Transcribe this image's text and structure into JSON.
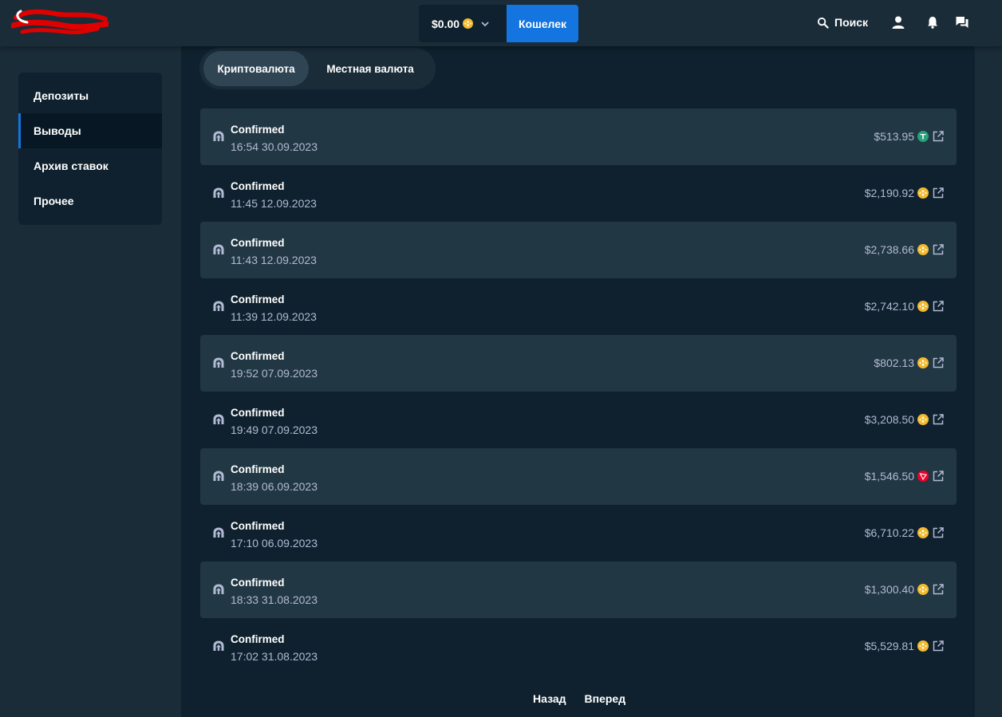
{
  "header": {
    "balance": "$0.00",
    "wallet_label": "Кошелек",
    "search_label": "Поиск"
  },
  "sidebar": {
    "items": [
      {
        "label": "Депозиты"
      },
      {
        "label": "Выводы"
      },
      {
        "label": "Архив ставок"
      },
      {
        "label": "Прочее"
      }
    ]
  },
  "tabs": {
    "crypto": "Криптовалюта",
    "local": "Местная валюта"
  },
  "transactions": [
    {
      "status": "Confirmed",
      "date": "16:54 30.09.2023",
      "amount": "$513.95",
      "currency": "usdt"
    },
    {
      "status": "Confirmed",
      "date": "11:45 12.09.2023",
      "amount": "$2,190.92",
      "currency": "bnb"
    },
    {
      "status": "Confirmed",
      "date": "11:43 12.09.2023",
      "amount": "$2,738.66",
      "currency": "bnb"
    },
    {
      "status": "Confirmed",
      "date": "11:39 12.09.2023",
      "amount": "$2,742.10",
      "currency": "bnb"
    },
    {
      "status": "Confirmed",
      "date": "19:52 07.09.2023",
      "amount": "$802.13",
      "currency": "bnb"
    },
    {
      "status": "Confirmed",
      "date": "19:49 07.09.2023",
      "amount": "$3,208.50",
      "currency": "bnb"
    },
    {
      "status": "Confirmed",
      "date": "18:39 06.09.2023",
      "amount": "$1,546.50",
      "currency": "trx"
    },
    {
      "status": "Confirmed",
      "date": "17:10 06.09.2023",
      "amount": "$6,710.22",
      "currency": "bnb"
    },
    {
      "status": "Confirmed",
      "date": "18:33 31.08.2023",
      "amount": "$1,300.40",
      "currency": "bnb"
    },
    {
      "status": "Confirmed",
      "date": "17:02 31.08.2023",
      "amount": "$5,529.81",
      "currency": "bnb"
    }
  ],
  "pager": {
    "prev": "Назад",
    "next": "Вперед"
  },
  "colors": {
    "accent": "#1475e1",
    "usdt": "#26a17b",
    "bnb": "#f3ba2f",
    "trx": "#ef0027"
  }
}
